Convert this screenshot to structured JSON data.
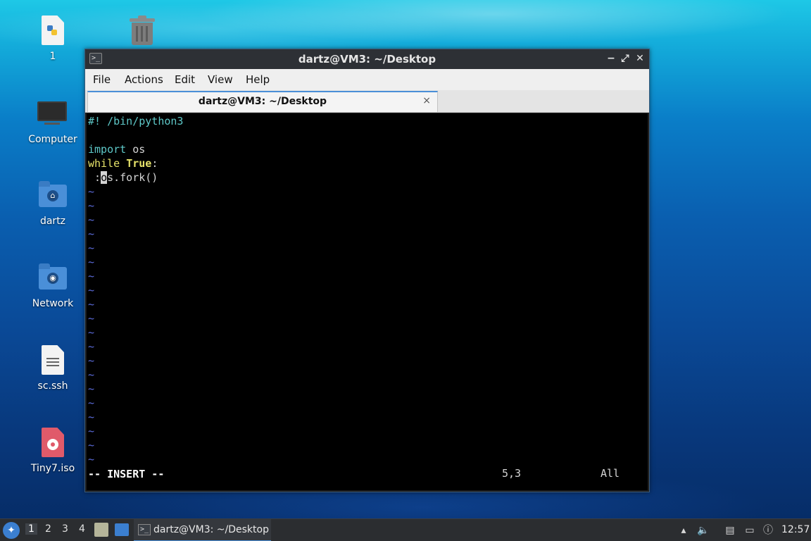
{
  "desktop": {
    "icons": [
      {
        "label": "1",
        "icon": "python-file-icon"
      },
      {
        "label": "Computer",
        "icon": "computer-icon"
      },
      {
        "label": "dartz",
        "icon": "home-folder-icon"
      },
      {
        "label": "Network",
        "icon": "network-folder-icon"
      },
      {
        "label": "sc.ssh",
        "icon": "text-file-icon"
      },
      {
        "label": "Tiny7.iso",
        "icon": "disc-image-icon"
      }
    ],
    "trash_icon": "trash-icon"
  },
  "window": {
    "title": "dartz@VM3: ~/Desktop",
    "controls": {
      "minimize": "−",
      "maximize": "⤢",
      "close": "✕"
    },
    "menu": [
      "File",
      "Actions",
      "Edit",
      "View",
      "Help"
    ],
    "tab": {
      "title": "dartz@VM3: ~/Desktop",
      "close": "×"
    }
  },
  "editor": {
    "lines": {
      "shebang": "#! /bin/python3",
      "import_kw": "import",
      "import_mod": " os",
      "while_kw": "while",
      "true_kw": "True",
      "colon": ":",
      "line5_prefix": " :",
      "cursor_char": "o",
      "line5_rest": "s.fork()"
    },
    "tilde": "~",
    "mode": "-- INSERT --",
    "position": "5,3",
    "scroll": "All"
  },
  "taskbar": {
    "start_icon": "lxqt-start-icon",
    "workspaces": [
      "1",
      "2",
      "3",
      "4"
    ],
    "active_workspace": "1",
    "task_label": "dartz@VM3: ~/Desktop",
    "clock": "12:57",
    "tray_icons": [
      "expand-tray-icon",
      "volume-icon",
      "clipboard-icon",
      "network-icon",
      "update-notifier-icon"
    ]
  }
}
